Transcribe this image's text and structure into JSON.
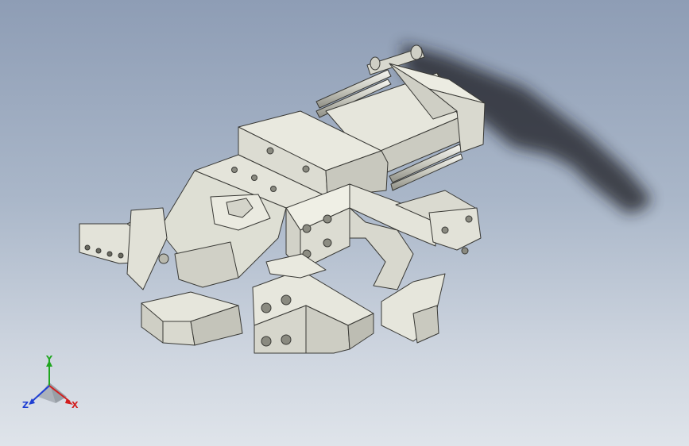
{
  "viewport": {
    "background_top": "#8e9db5",
    "background_bottom": "#dfe4ea"
  },
  "model": {
    "part_color": "#e3e3d6",
    "shadow_color": "#1c1e22",
    "edge_color": "#3a3a36",
    "description": ""
  },
  "triad": {
    "x_label": "X",
    "y_label": "Y",
    "z_label": "Z",
    "x_color": "#d21f1f",
    "y_color": "#1fa61f",
    "z_color": "#1f3fd2"
  }
}
